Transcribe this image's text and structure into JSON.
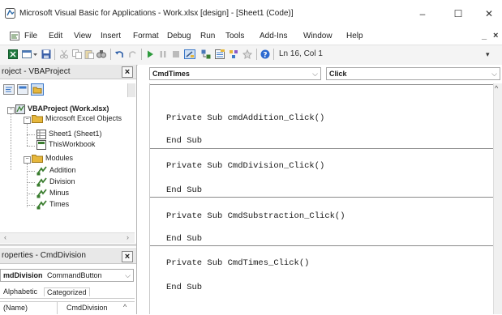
{
  "window": {
    "title": "Microsoft Visual Basic for Applications - Work.xlsx [design] - [Sheet1 (Code)]",
    "minimize_glyph": "–",
    "maximize_glyph": "☐",
    "close_glyph": "✕"
  },
  "menubar": {
    "items": [
      "File",
      "Edit",
      "View",
      "Insert",
      "Format",
      "Debug",
      "Run",
      "Tools",
      "Add-Ins",
      "Window",
      "Help"
    ],
    "mdi_minimize": "_",
    "mdi_close": "×"
  },
  "toolbar": {
    "position_status": "Ln 16, Col 1",
    "icons": [
      "excel-view-icon",
      "insert-module-icon",
      "save-icon",
      "cut-icon",
      "copy-icon",
      "paste-icon",
      "find-icon",
      "undo-icon",
      "redo-icon",
      "run-icon",
      "break-icon",
      "reset-icon",
      "design-mode-icon",
      "project-explorer-icon",
      "properties-icon",
      "object-browser-icon",
      "toolbox-icon",
      "help-icon"
    ]
  },
  "project_pane": {
    "title": "roject - VBAProject",
    "close_glyph": "×",
    "tree": {
      "root": "VBAProject (Work.xlsx)",
      "excel_objects_folder": "Microsoft Excel Objects",
      "sheet1": "Sheet1 (Sheet1)",
      "this_workbook": "ThisWorkbook",
      "modules_folder": "Modules",
      "modules": [
        "Addition",
        "Division",
        "Minus",
        "Times"
      ]
    }
  },
  "properties_pane": {
    "title": "roperties - CmdDivision",
    "close_glyph": "×",
    "object_name": "mdDivision",
    "object_type": "CommandButton",
    "tab_alphabetic": "Alphabetic",
    "tab_categorized": "Categorized",
    "row_name": "(Name)",
    "row_value": "CmdDivision"
  },
  "code_window": {
    "object_combo": "CmdTimes",
    "procedure_combo": "Click",
    "procedures": [
      {
        "signature": "Private Sub cmdAddition_Click()",
        "end": "End Sub"
      },
      {
        "signature": "Private Sub CmdDivision_Click()",
        "end": "End Sub"
      },
      {
        "signature": "Private Sub CmdSubstraction_Click()",
        "end": "End Sub"
      },
      {
        "signature": "Private Sub CmdTimes_Click()",
        "end": "End Sub"
      }
    ]
  },
  "colors": {
    "accent_folder": "#e6b73c",
    "module_icon": "#3a7d2f",
    "selection_blue": "#3c78c8"
  }
}
